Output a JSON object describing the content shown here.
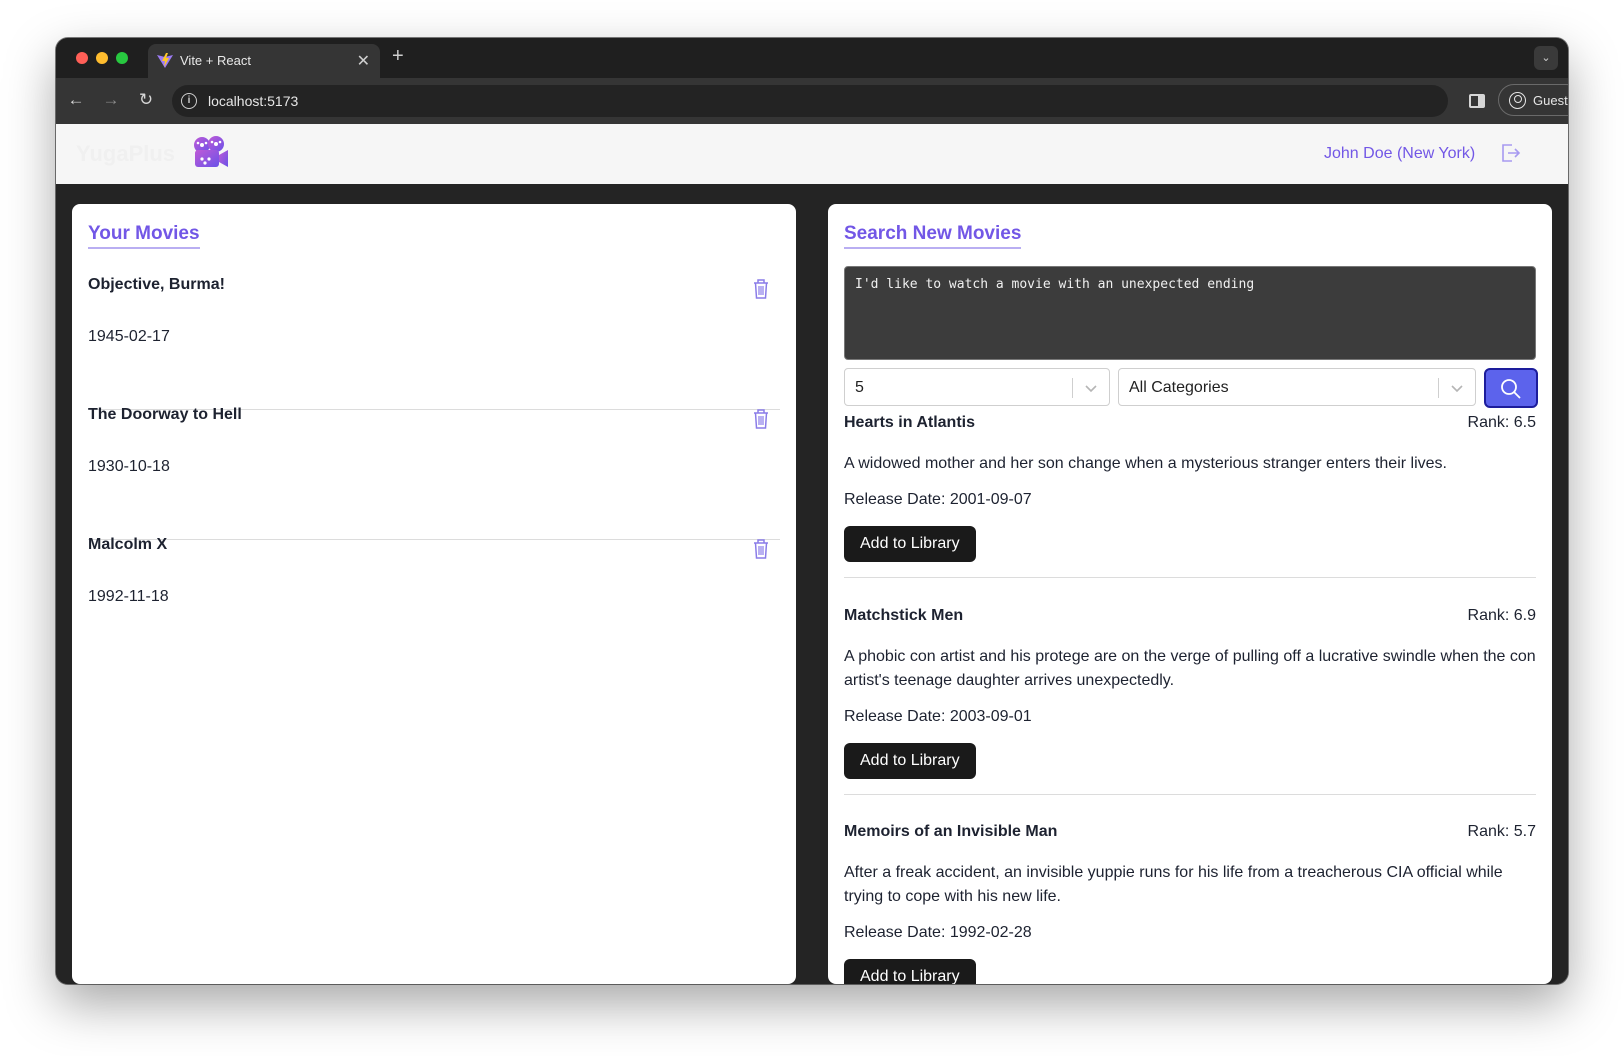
{
  "browser": {
    "tab_title": "Vite + React",
    "tab_close": "✕",
    "new_tab": "+",
    "tab_menu": "⌄",
    "url": "localhost:5173",
    "profile_label": "Guest",
    "menu_glyph": "⋮",
    "back_glyph": "←",
    "forward_glyph": "→",
    "reload_glyph": "↻"
  },
  "app": {
    "brand": "YugaPlus",
    "user": "John Doe (New York)",
    "accent_color": "#7257e6"
  },
  "library": {
    "heading": "Your Movies",
    "movies": [
      {
        "title": "Objective, Burma!",
        "date": "1945-02-17"
      },
      {
        "title": "The Doorway to Hell",
        "date": "1930-10-18"
      },
      {
        "title": "Malcolm X",
        "date": "1992-11-18"
      }
    ]
  },
  "search": {
    "heading": "Search New Movies",
    "query": "I'd like to watch a movie with an unexpected ending",
    "count": "5",
    "category": "All Categories",
    "add_label": "Add to Library",
    "results": [
      {
        "title": "Hearts in Atlantis",
        "rank": "Rank: 6.5",
        "description": "A widowed mother and her son change when a mysterious stranger enters their lives.",
        "release": "Release Date: 2001-09-07"
      },
      {
        "title": "Matchstick Men",
        "rank": "Rank: 6.9",
        "description": "A phobic con artist and his protege are on the verge of pulling off a lucrative swindle when the con artist's teenage daughter arrives unexpectedly.",
        "release": "Release Date: 2003-09-01"
      },
      {
        "title": "Memoirs of an Invisible Man",
        "rank": "Rank: 5.7",
        "description": "After a freak accident, an invisible yuppie runs for his life from a treacherous CIA official while trying to cope with his new life.",
        "release": "Release Date: 1992-02-28"
      }
    ]
  }
}
